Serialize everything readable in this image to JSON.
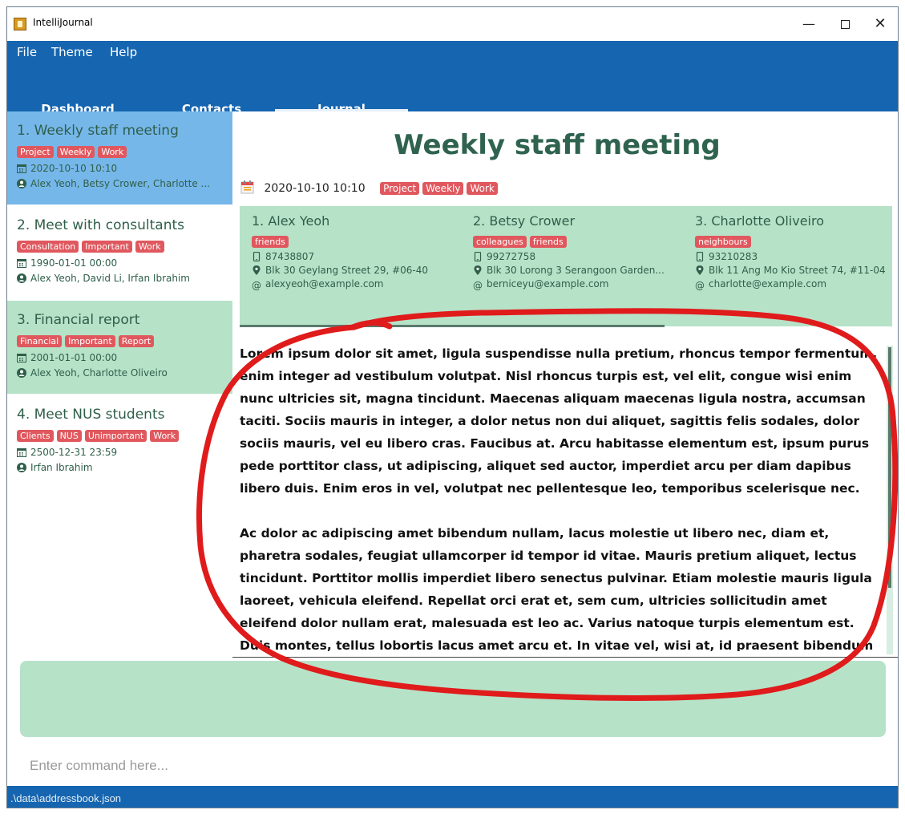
{
  "window": {
    "title": "IntelliJournal"
  },
  "menu": {
    "items": [
      "File",
      "Theme",
      "Help"
    ]
  },
  "tabs": [
    {
      "label": "Dashboard",
      "active": false
    },
    {
      "label": "Contacts",
      "active": false
    },
    {
      "label": "Journal",
      "active": true
    }
  ],
  "entries": [
    {
      "title": "1.  Weekly staff meeting",
      "tags": [
        "Project",
        "Weekly",
        "Work"
      ],
      "date": "2020-10-10 10:10",
      "people": "Alex Yeoh, Betsy Crower, Charlotte ...",
      "state": "selected"
    },
    {
      "title": "2.  Meet with consultants",
      "tags": [
        "Consultation",
        "Important",
        "Work"
      ],
      "date": "1990-01-01 00:00",
      "people": "Alex Yeoh, David Li, Irfan Ibrahim",
      "state": "normal"
    },
    {
      "title": "3.  Financial report",
      "tags": [
        "Financial",
        "Important",
        "Report"
      ],
      "date": "2001-01-01 00:00",
      "people": "Alex Yeoh, Charlotte Oliveiro",
      "state": "alt"
    },
    {
      "title": "4.  Meet NUS students",
      "tags": [
        "Clients",
        "NUS",
        "Unimportant",
        "Work"
      ],
      "date": "2500-12-31 23:59",
      "people": "Irfan Ibrahim",
      "state": "normal"
    }
  ],
  "detail": {
    "title": "Weekly staff meeting",
    "date": "2020-10-10 10:10",
    "tags": [
      "Project",
      "Weekly",
      "Work"
    ],
    "contacts": [
      {
        "name": "1.  Alex Yeoh",
        "tags": [
          "friends"
        ],
        "phone": "87438807",
        "address": "Blk 30 Geylang Street 29, #06-40",
        "email": "alexyeoh@example.com"
      },
      {
        "name": "2.  Betsy Crower",
        "tags": [
          "colleagues",
          "friends"
        ],
        "phone": "99272758",
        "address": "Blk 30 Lorong 3 Serangoon Garden...",
        "email": "berniceyu@example.com"
      },
      {
        "name": "3.  Charlotte Oliveiro",
        "tags": [
          "neighbours"
        ],
        "phone": "93210283",
        "address": "Blk 11 Ang Mo Kio Street 74, #11-04",
        "email": "charlotte@example.com"
      }
    ],
    "paragraphs": [
      "Lorem ipsum dolor sit amet, ligula suspendisse nulla pretium, rhoncus tempor fermentum, enim integer ad vestibulum volutpat. Nisl rhoncus turpis est, vel elit, congue wisi enim nunc ultricies sit, magna tincidunt. Maecenas aliquam maecenas ligula nostra, accumsan taciti. Sociis mauris in integer, a dolor netus non dui aliquet, sagittis felis sodales, dolor sociis mauris, vel eu libero cras. Faucibus at. Arcu habitasse elementum est, ipsum purus pede porttitor class, ut adipiscing, aliquet sed auctor, imperdiet arcu per diam dapibus libero duis. Enim eros in vel, volutpat nec pellentesque leo, temporibus scelerisque nec.",
      "Ac dolor ac adipiscing amet bibendum nullam, lacus molestie ut libero nec, diam et, pharetra sodales, feugiat ullamcorper id tempor id vitae. Mauris pretium aliquet, lectus tincidunt. Porttitor mollis imperdiet libero senectus pulvinar. Etiam molestie mauris ligula laoreet, vehicula eleifend. Repellat orci erat et, sem cum, ultricies sollicitudin amet eleifend dolor nullam erat, malesuada est leo ac. Varius natoque turpis elementum est. Duis montes, tellus lobortis lacus amet arcu et. In vitae vel, wisi at, id praesent bibendum libero faucibus porta."
    ]
  },
  "command": {
    "placeholder": "Enter command here..."
  },
  "status": {
    "path": ".\\data\\addressbook.json"
  },
  "colors": {
    "accent": "#1565b0",
    "selected": "#76b7ea",
    "card": "#b6e2c8",
    "tag": "#e0585e",
    "annotation": "#e01b1b"
  }
}
